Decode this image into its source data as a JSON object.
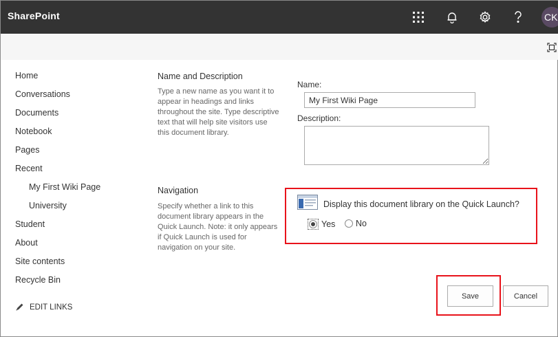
{
  "app": {
    "brand": "SharePoint",
    "avatar_initials": "CK"
  },
  "topbar_icons": [
    "waffle-icon",
    "bell-icon",
    "gear-icon",
    "help-icon"
  ],
  "left_nav": {
    "items": [
      {
        "label": "Home"
      },
      {
        "label": "Conversations"
      },
      {
        "label": "Documents"
      },
      {
        "label": "Notebook"
      },
      {
        "label": "Pages"
      },
      {
        "label": "Recent"
      },
      {
        "label": "My First Wiki Page"
      },
      {
        "label": "University"
      },
      {
        "label": "Student"
      },
      {
        "label": "About"
      },
      {
        "label": "Site contents"
      },
      {
        "label": "Recycle Bin"
      }
    ],
    "edit_links": "EDIT LINKS"
  },
  "name_section": {
    "title": "Name and Description",
    "description": "Type a new name as you want it to appear in headings and links throughout the site. Type descriptive text that will help site visitors use this document library.",
    "name_label": "Name:",
    "name_value": "My First Wiki Page",
    "description_label": "Description:",
    "description_value": ""
  },
  "navigation_section": {
    "title": "Navigation",
    "description": "Specify whether a link to this document library appears in the Quick Launch. Note: it only appears if Quick Launch is used for navigation on your site.",
    "question": "Display this document library on the Quick Launch?",
    "options": [
      {
        "label": "Yes",
        "selected": true
      },
      {
        "label": "No",
        "selected": false
      }
    ]
  },
  "actions": {
    "save_label": "Save",
    "cancel_label": "Cancel"
  },
  "colors": {
    "topbar": "#333333",
    "highlight": "#e8121a",
    "avatar": "#5a4a63"
  }
}
